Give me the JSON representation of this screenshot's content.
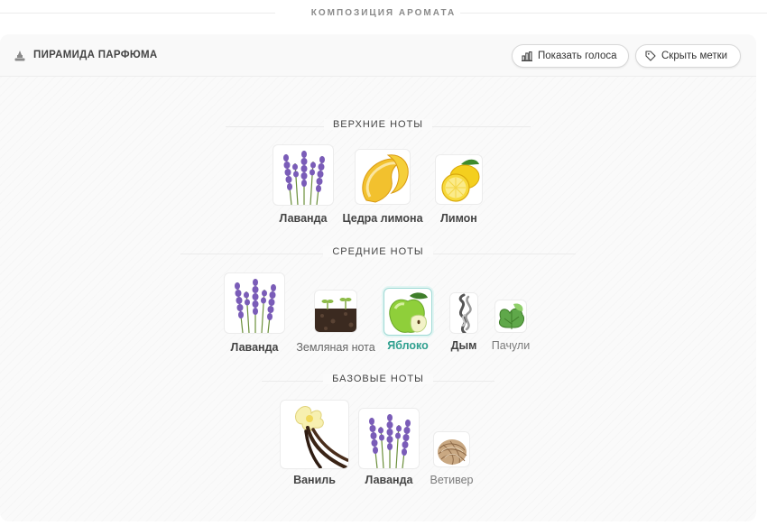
{
  "section_title": "КОМПОЗИЦИЯ АРОМАТА",
  "header": {
    "title": "ПИРАМИДА ПАРФЮМА",
    "show_votes_label": "Показать голоса",
    "hide_tags_label": "Скрыть метки"
  },
  "tiers": [
    {
      "label": "ВЕРХНИЕ НОТЫ",
      "notes": [
        {
          "name": "Лаванда",
          "icon": "lavender-icon"
        },
        {
          "name": "Цедра лимона",
          "icon": "lemon-zest-icon"
        },
        {
          "name": "Лимон",
          "icon": "lemon-icon"
        }
      ]
    },
    {
      "label": "СРЕДНИЕ НОТЫ",
      "notes": [
        {
          "name": "Лаванда",
          "icon": "lavender-icon"
        },
        {
          "name": "Земляная нота",
          "icon": "earth-icon"
        },
        {
          "name": "Яблоко",
          "icon": "apple-icon",
          "selected": true
        },
        {
          "name": "Дым",
          "icon": "smoke-icon"
        },
        {
          "name": "Пачули",
          "icon": "patchouli-icon"
        }
      ]
    },
    {
      "label": "БАЗОВЫЕ НОТЫ",
      "notes": [
        {
          "name": "Ваниль",
          "icon": "vanilla-icon"
        },
        {
          "name": "Лаванда",
          "icon": "lavender-icon"
        },
        {
          "name": "Ветивер",
          "icon": "vetiver-icon"
        }
      ]
    }
  ]
}
